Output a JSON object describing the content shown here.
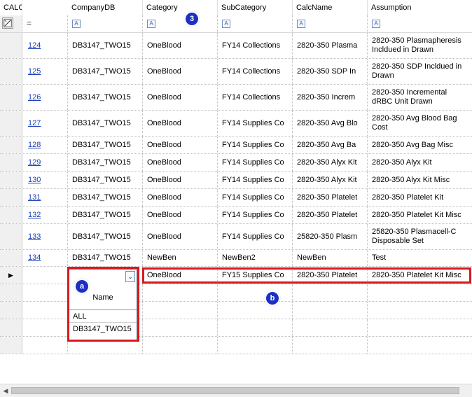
{
  "columns": [
    "CALCID",
    "CompanyDB",
    "Category",
    "SubCategory",
    "CalcName",
    "Assumption"
  ],
  "filter_row": {
    "equals_symbol": "=",
    "filter_icon_glyph": "A"
  },
  "rows": [
    {
      "id": "124",
      "db": "DB3147_TWO15",
      "category": "OneBlood",
      "subcategory": "FY14 Collections",
      "calcname": "2820-350 Plasma",
      "assumption": "2820-350 Plasmapheresis Incldued in Drawn"
    },
    {
      "id": "125",
      "db": "DB3147_TWO15",
      "category": "OneBlood",
      "subcategory": "FY14 Collections",
      "calcname": "2820-350 SDP In",
      "assumption": "2820-350 SDP Incldued in Drawn"
    },
    {
      "id": "126",
      "db": "DB3147_TWO15",
      "category": "OneBlood",
      "subcategory": "FY14 Collections",
      "calcname": "2820-350 Increm",
      "assumption": "2820-350 Incremental dRBC Unit Drawn"
    },
    {
      "id": "127",
      "db": "DB3147_TWO15",
      "category": "OneBlood",
      "subcategory": "FY14 Supplies Co",
      "calcname": "2820-350 Avg Blo",
      "assumption": "2820-350 Avg Blood Bag Cost"
    },
    {
      "id": "128",
      "db": "DB3147_TWO15",
      "category": "OneBlood",
      "subcategory": "FY14 Supplies Co",
      "calcname": "2820-350 Avg Ba",
      "assumption": "2820-350 Avg Bag Misc"
    },
    {
      "id": "129",
      "db": "DB3147_TWO15",
      "category": "OneBlood",
      "subcategory": "FY14 Supplies Co",
      "calcname": "2820-350 Alyx Kit",
      "assumption": "2820-350 Alyx Kit"
    },
    {
      "id": "130",
      "db": "DB3147_TWO15",
      "category": "OneBlood",
      "subcategory": "FY14 Supplies Co",
      "calcname": "2820-350 Alyx Kit",
      "assumption": "2820-350 Alyx Kit Misc"
    },
    {
      "id": "131",
      "db": "DB3147_TWO15",
      "category": "OneBlood",
      "subcategory": "FY14 Supplies Co",
      "calcname": "2820-350 Platelet",
      "assumption": "2820-350 Platelet Kit"
    },
    {
      "id": "132",
      "db": "DB3147_TWO15",
      "category": "OneBlood",
      "subcategory": "FY14 Supplies Co",
      "calcname": "2820-350 Platelet",
      "assumption": "2820-350 Platelet Kit Misc"
    },
    {
      "id": "133",
      "db": "DB3147_TWO15",
      "category": "OneBlood",
      "subcategory": "FY14 Supplies Co",
      "calcname": "25820-350 Plasm",
      "assumption": "25820-350 Plasmacell-C Disposable Set"
    },
    {
      "id": "134",
      "db": "DB3147_TWO15",
      "category": "NewBen",
      "subcategory": "NewBen2",
      "calcname": "NewBen",
      "assumption": "Test"
    }
  ],
  "new_row": {
    "indicator": "▶",
    "category": "OneBlood",
    "subcategory": "FY15 Supplies Co",
    "calcname": "2820-350 Platelet",
    "assumption": "2820-350 Platelet Kit Misc"
  },
  "dropdown": {
    "header": "Name",
    "options": [
      "ALL",
      "DB3147_TWO15"
    ],
    "button_glyph": "⌄"
  },
  "badges": {
    "a": "a",
    "b": "b",
    "c": "3"
  },
  "colors": {
    "highlight": "#d71920",
    "badge": "#1d2fc4",
    "link": "#1a3fb8"
  }
}
